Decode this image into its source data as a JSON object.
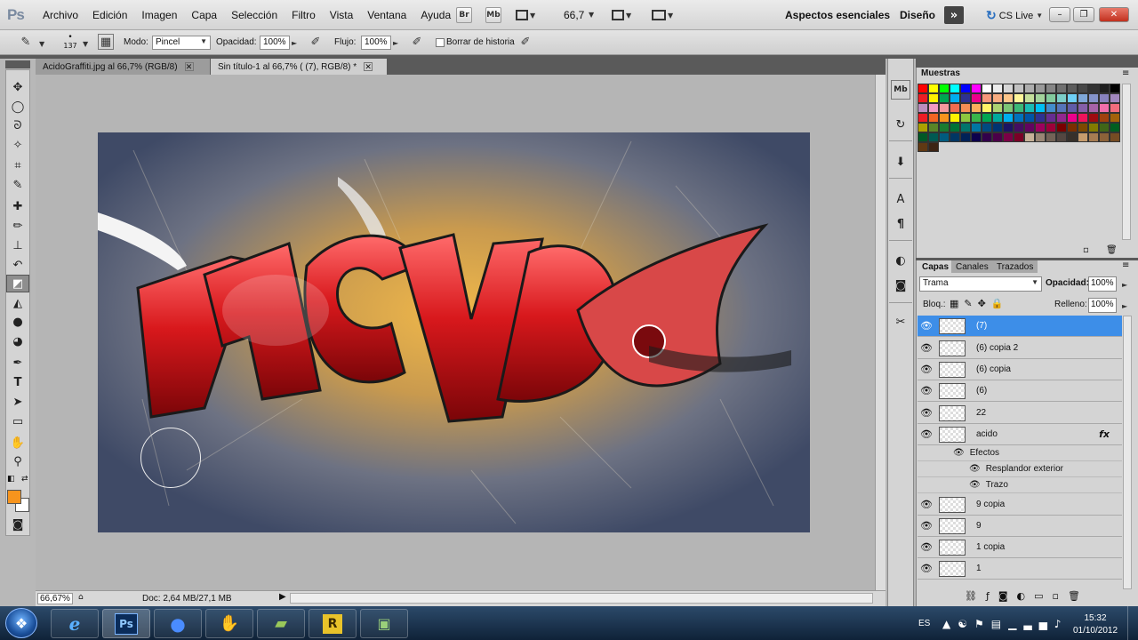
{
  "app": {
    "logo": "Ps"
  },
  "menu": [
    "Archivo",
    "Edición",
    "Imagen",
    "Capa",
    "Selección",
    "Filtro",
    "Vista",
    "Ventana",
    "Ayuda"
  ],
  "menubar_buttons": {
    "bridge": "Br",
    "minibridge": "Mb"
  },
  "zoom": "66,7",
  "workspace": {
    "essentials": "Aspectos esenciales",
    "design": "Diseño",
    "more": "»",
    "cslive": "CS Live"
  },
  "window_controls": {
    "minimize": "–",
    "restore": "❐",
    "close": "✕"
  },
  "options": {
    "brush_size": "137",
    "mode_label": "Modo:",
    "mode_value": "Pincel",
    "opacity_label": "Opacidad:",
    "opacity_value": "100%",
    "flow_label": "Flujo:",
    "flow_value": "100%",
    "erase_history_label": "Borrar de historia"
  },
  "tabs": [
    {
      "label": "AcidoGraffiti.jpg al 66,7% (RGB/8)",
      "close": "✕"
    },
    {
      "label": "Sin título-1 al 66,7% ( (7), RGB/8) *",
      "close": "✕"
    }
  ],
  "status": {
    "zoom": "66,67%",
    "doc": "Doc: 2,64 MB/27,1 MB"
  },
  "swatches": {
    "tab_label": "Muestras",
    "colors": [
      "#ff0000",
      "#ffff00",
      "#00ff00",
      "#00ffff",
      "#0000ff",
      "#ff00ff",
      "#ffffff",
      "#ebebeb",
      "#d6d6d6",
      "#c2c2c2",
      "#adadad",
      "#999999",
      "#858585",
      "#707070",
      "#5c5c5c",
      "#474747",
      "#333333",
      "#1f1f1f",
      "#000000",
      "#ed1c24",
      "#fff200",
      "#00a651",
      "#00aeef",
      "#2e3192",
      "#ec008c",
      "#f7977a",
      "#f9ad81",
      "#fdc68a",
      "#fff79a",
      "#c4df9b",
      "#a3d39c",
      "#82ca9d",
      "#7bcdc8",
      "#6ecff6",
      "#7ea7d8",
      "#8493ca",
      "#8882be",
      "#a187be",
      "#bc8dbf",
      "#f49ac2",
      "#f6989d",
      "#f26c4f",
      "#f68e55",
      "#fbaf5c",
      "#fff467",
      "#acd372",
      "#7cc576",
      "#3bb878",
      "#1abbb4",
      "#00bff3",
      "#438ccb",
      "#5574b9",
      "#605ca8",
      "#855fa8",
      "#a763a8",
      "#f06eaa",
      "#f26d7d",
      "#ed1c24",
      "#f26522",
      "#f7941d",
      "#fff200",
      "#8dc63f",
      "#39b54a",
      "#00a651",
      "#00a99d",
      "#00aeef",
      "#0072bc",
      "#0054a6",
      "#2e3192",
      "#662d91",
      "#92278f",
      "#ec008c",
      "#ed145b",
      "#9e0b0f",
      "#a0410d",
      "#a36209",
      "#aba000",
      "#598527",
      "#197b30",
      "#007236",
      "#00746b",
      "#0076a3",
      "#004a80",
      "#003471",
      "#1b1464",
      "#440e62",
      "#630460",
      "#9e005d",
      "#9e0039",
      "#790000",
      "#7b2e00",
      "#7d4900",
      "#827b00",
      "#406618",
      "#005e20",
      "#005826",
      "#005952",
      "#005b7f",
      "#003663",
      "#002157",
      "#0d004c",
      "#32004b",
      "#4b0049",
      "#7b0046",
      "#7a0026",
      "#c7b299",
      "#998675",
      "#736357",
      "#534741",
      "#37302a",
      "#c69c6d",
      "#a67c52",
      "#8c6239",
      "#754c24",
      "#603913",
      "#3c2415"
    ]
  },
  "layers": {
    "tabs": [
      "Capas",
      "Canales",
      "Trazados"
    ],
    "blend_mode": "Trama",
    "opacity_label": "Opacidad:",
    "opacity_value": "100%",
    "lock_label": "Bloq.:",
    "fill_label": "Relleno:",
    "fill_value": "100%",
    "items": [
      {
        "name": "(7)",
        "selected": true
      },
      {
        "name": "(6) copia 2"
      },
      {
        "name": "(6) copia"
      },
      {
        "name": "(6)"
      },
      {
        "name": "22"
      },
      {
        "name": "acido",
        "fx": "fx"
      }
    ],
    "effects_label": "Efectos",
    "effects": [
      "Resplandor exterior",
      "Trazo"
    ],
    "items_after": [
      "9 copia",
      "9",
      "1 copia",
      "1"
    ]
  },
  "taskbar": {
    "lang": "ES",
    "time": "15:32",
    "date": "01/10/2012",
    "apps": [
      "Ps",
      "R"
    ]
  }
}
